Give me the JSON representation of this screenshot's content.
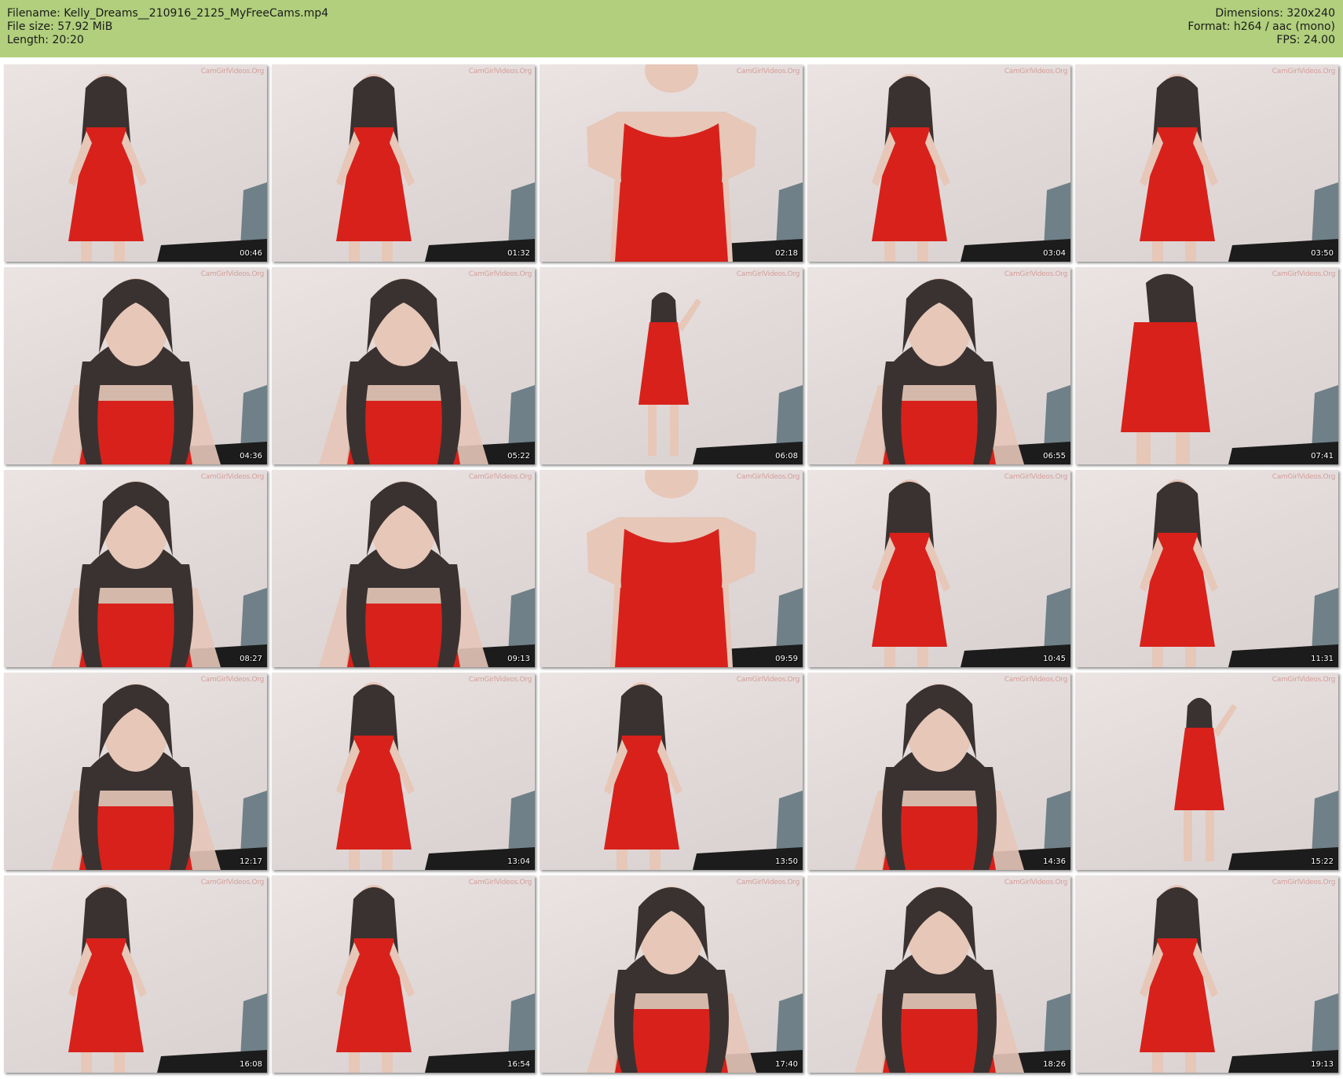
{
  "info": {
    "filename": "Filename: Kelly_Dreams__210916_2125_MyFreeCams.mp4",
    "filesize": "File size: 57.92 MiB",
    "length": "Length: 20:20",
    "dimensions": "Dimensions: 320x240",
    "format": "Format: h264 / aac (mono)",
    "fps": "FPS: 24.00"
  },
  "watermark": "CamGirlVideos.Org",
  "thumbnails": [
    {
      "time": "00:46",
      "pose": "full"
    },
    {
      "time": "01:32",
      "pose": "full"
    },
    {
      "time": "02:18",
      "pose": "torso"
    },
    {
      "time": "03:04",
      "pose": "full"
    },
    {
      "time": "03:50",
      "pose": "full"
    },
    {
      "time": "04:36",
      "pose": "close"
    },
    {
      "time": "05:22",
      "pose": "close"
    },
    {
      "time": "06:08",
      "pose": "far"
    },
    {
      "time": "06:55",
      "pose": "close"
    },
    {
      "time": "07:41",
      "pose": "back"
    },
    {
      "time": "08:27",
      "pose": "close"
    },
    {
      "time": "09:13",
      "pose": "close"
    },
    {
      "time": "09:59",
      "pose": "torso"
    },
    {
      "time": "10:45",
      "pose": "full"
    },
    {
      "time": "11:31",
      "pose": "full"
    },
    {
      "time": "12:17",
      "pose": "close"
    },
    {
      "time": "13:04",
      "pose": "full"
    },
    {
      "time": "13:50",
      "pose": "full"
    },
    {
      "time": "14:36",
      "pose": "close"
    },
    {
      "time": "15:22",
      "pose": "far"
    },
    {
      "time": "16:08",
      "pose": "full"
    },
    {
      "time": "16:54",
      "pose": "full"
    },
    {
      "time": "17:40",
      "pose": "close"
    },
    {
      "time": "18:26",
      "pose": "close"
    },
    {
      "time": "19:13",
      "pose": "full"
    }
  ],
  "colors": {
    "header": "#b1cf7d",
    "dress": "#d8211b",
    "hair": "#3a3230",
    "skin": "#e6c7b8",
    "chair": "#6f8088",
    "sofa": "#1c1c1c"
  }
}
